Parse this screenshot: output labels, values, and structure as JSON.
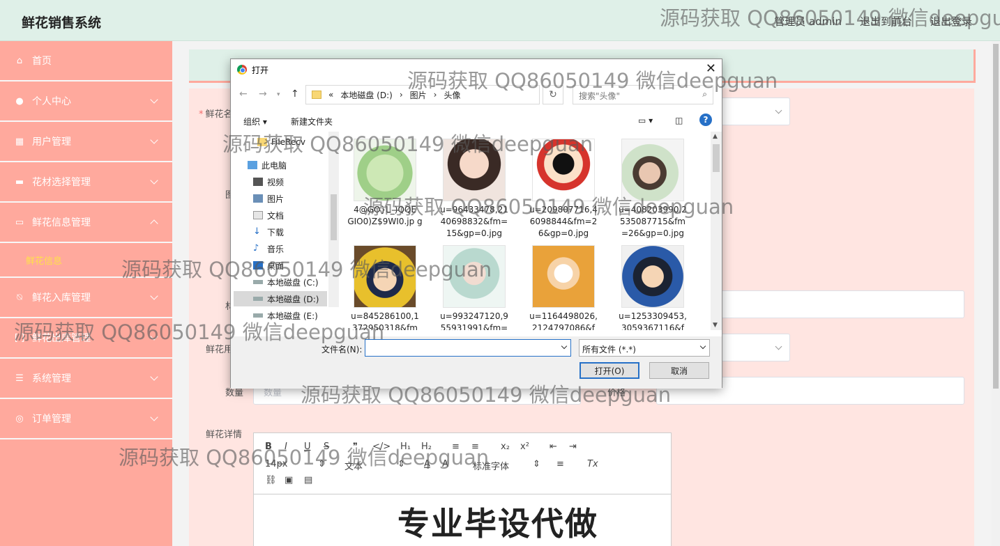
{
  "header": {
    "title": "鲜花销售系统",
    "links": [
      "管理员 admin",
      "退出到前台",
      "退出登录"
    ]
  },
  "sidebar": {
    "items": [
      {
        "label": "首页",
        "icon": "home-icon"
      },
      {
        "label": "个人中心",
        "icon": "user-icon"
      },
      {
        "label": "用户管理",
        "icon": "grid-icon"
      },
      {
        "label": "花材选择管理",
        "icon": "box-icon"
      },
      {
        "label": "鲜花信息管理",
        "icon": "chat-icon",
        "expanded": true
      },
      {
        "label": "鲜花入库管理",
        "icon": "bell-icon"
      },
      {
        "label": "鲜花出库管理",
        "icon": "bracket-icon"
      },
      {
        "label": "系统管理",
        "icon": "sliders-icon"
      },
      {
        "label": "订单管理",
        "icon": "compass-icon"
      }
    ],
    "sub_item": "鲜花信息"
  },
  "form": {
    "name_label": "鲜花名",
    "image_label": "图",
    "material_label": "材",
    "use_label": "鲜花用",
    "quantity_label": "数量",
    "quantity_placeholder": "数量",
    "price_label": "价格",
    "detail_label": "鲜花详情",
    "editor_font_size": "14px",
    "editor_format": "文本",
    "editor_font": "标准字体",
    "editor_content": "专业毕设代做"
  },
  "dialog": {
    "title": "打开",
    "path": [
      "本地磁盘 (D:)",
      "图片",
      "头像"
    ],
    "path_prefix": "«",
    "search_placeholder": "搜索\"头像\"",
    "organize": "组织 ▾",
    "new_folder": "新建文件夹",
    "nav_pane": [
      {
        "label": "FileRecv",
        "icon": "folder-icon"
      },
      {
        "label": "此电脑",
        "icon": "computer-icon"
      },
      {
        "label": "视频",
        "icon": "video-icon"
      },
      {
        "label": "图片",
        "icon": "picture-icon"
      },
      {
        "label": "文档",
        "icon": "document-icon"
      },
      {
        "label": "下载",
        "icon": "download-icon"
      },
      {
        "label": "音乐",
        "icon": "music-icon"
      },
      {
        "label": "桌面",
        "icon": "desktop-icon"
      },
      {
        "label": "本地磁盘 (C:)",
        "icon": "drive-icon"
      },
      {
        "label": "本地磁盘 (D:)",
        "icon": "drive-icon",
        "selected": true
      },
      {
        "label": "本地磁盘 (E:)",
        "icon": "drive-icon"
      }
    ],
    "files": [
      {
        "name": "4@GO}L_)QQE GIO0)Z$9WI0.jp g"
      },
      {
        "name": "u=96433478,21 40698832&fm= 15&gp=0.jpg"
      },
      {
        "name": "u=209807716,4 6098844&fm=2 6&gp=0.jpg"
      },
      {
        "name": "u=408203990,2 535087715&fm =26&gp=0.jpg"
      },
      {
        "name": "u=845286100,1 372950318&fm"
      },
      {
        "name": "u=993247120,9 55931991&fm="
      },
      {
        "name": "u=1164498026, 2124797086&f"
      },
      {
        "name": "u=1253309453, 3059367116&f"
      }
    ],
    "filename_label": "文件名(N):",
    "filename_value": "",
    "filetype": "所有文件 (*.*)",
    "open_button": "打开(O)",
    "cancel_button": "取消"
  },
  "watermarks": [
    "源码获取 QQ86050149 微信deepgu",
    "源码获取 QQ86050149 微信deepguan",
    "源码获取 QQ86050149 微信deepguan",
    "源码获取 QQ86050149 微信deepguan",
    "源码获取 QQ86050149 微信deepguan",
    "源码获取 QQ86050149 微信deepguan",
    "源码获取 QQ86050149 微信deepguan",
    "源码获取 QQ86050149 微信deepguan"
  ],
  "colors": {
    "sidebar": "#ffa99d",
    "header": "#dff0e8",
    "panel": "#ffe5e1",
    "active_sub": "#ffe14a"
  }
}
